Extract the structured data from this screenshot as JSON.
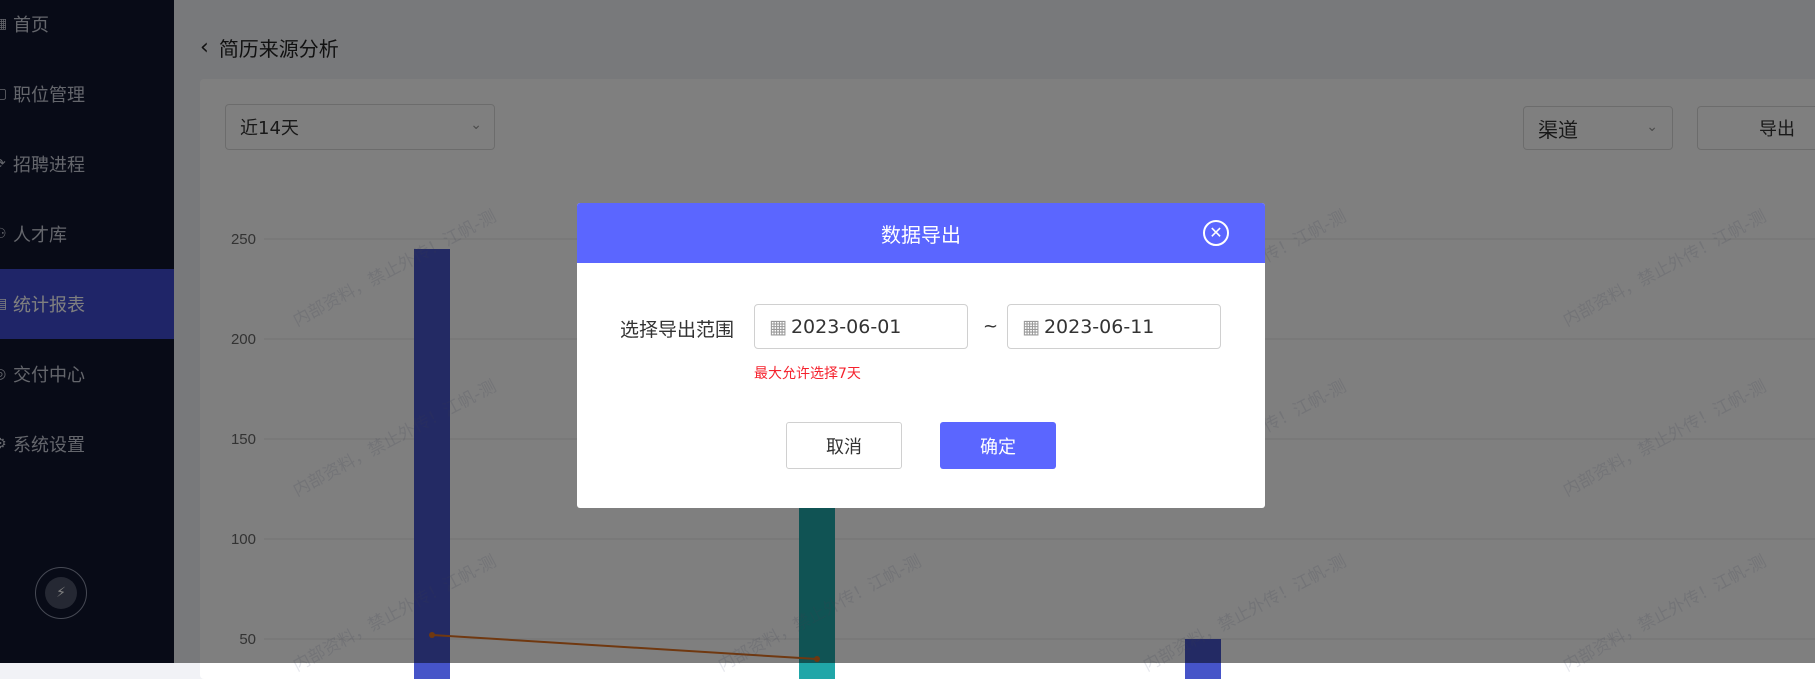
{
  "sidebar": {
    "items": [
      {
        "label": "首页",
        "icon": "grid-icon"
      },
      {
        "label": "职位管理",
        "icon": "briefcase-icon"
      },
      {
        "label": "招聘进程",
        "icon": "process-icon"
      },
      {
        "label": "人才库",
        "icon": "users-icon"
      },
      {
        "label": "统计报表",
        "icon": "report-icon",
        "active": true
      },
      {
        "label": "交付中心",
        "icon": "delivery-icon"
      },
      {
        "label": "系统设置",
        "icon": "gear-icon"
      }
    ]
  },
  "page": {
    "title": "简历来源分析"
  },
  "filters": {
    "range_value": "近14天",
    "channel_value": "渠道",
    "export_label": "导出"
  },
  "watermark_text": "内部资料，禁止外传！江帆-测",
  "chart_data": {
    "type": "bar",
    "y_ticks": [
      "250",
      "200",
      "150",
      "100",
      "50"
    ],
    "ylim": [
      0,
      250
    ],
    "bars": [
      {
        "value": 245,
        "color": "#4654c8"
      },
      {
        "value": 152,
        "color": "#20a6a8"
      },
      {
        "value": 50,
        "color": "#4654c8"
      }
    ],
    "line_points": [
      52,
      40
    ],
    "line_color": "#e07020"
  },
  "modal": {
    "title": "数据导出",
    "range_label": "选择导出范围",
    "start_date": "2023-06-01",
    "end_date": "2023-06-11",
    "separator": "~",
    "warning": "最大允许选择7天",
    "cancel_label": "取消",
    "confirm_label": "确定"
  }
}
